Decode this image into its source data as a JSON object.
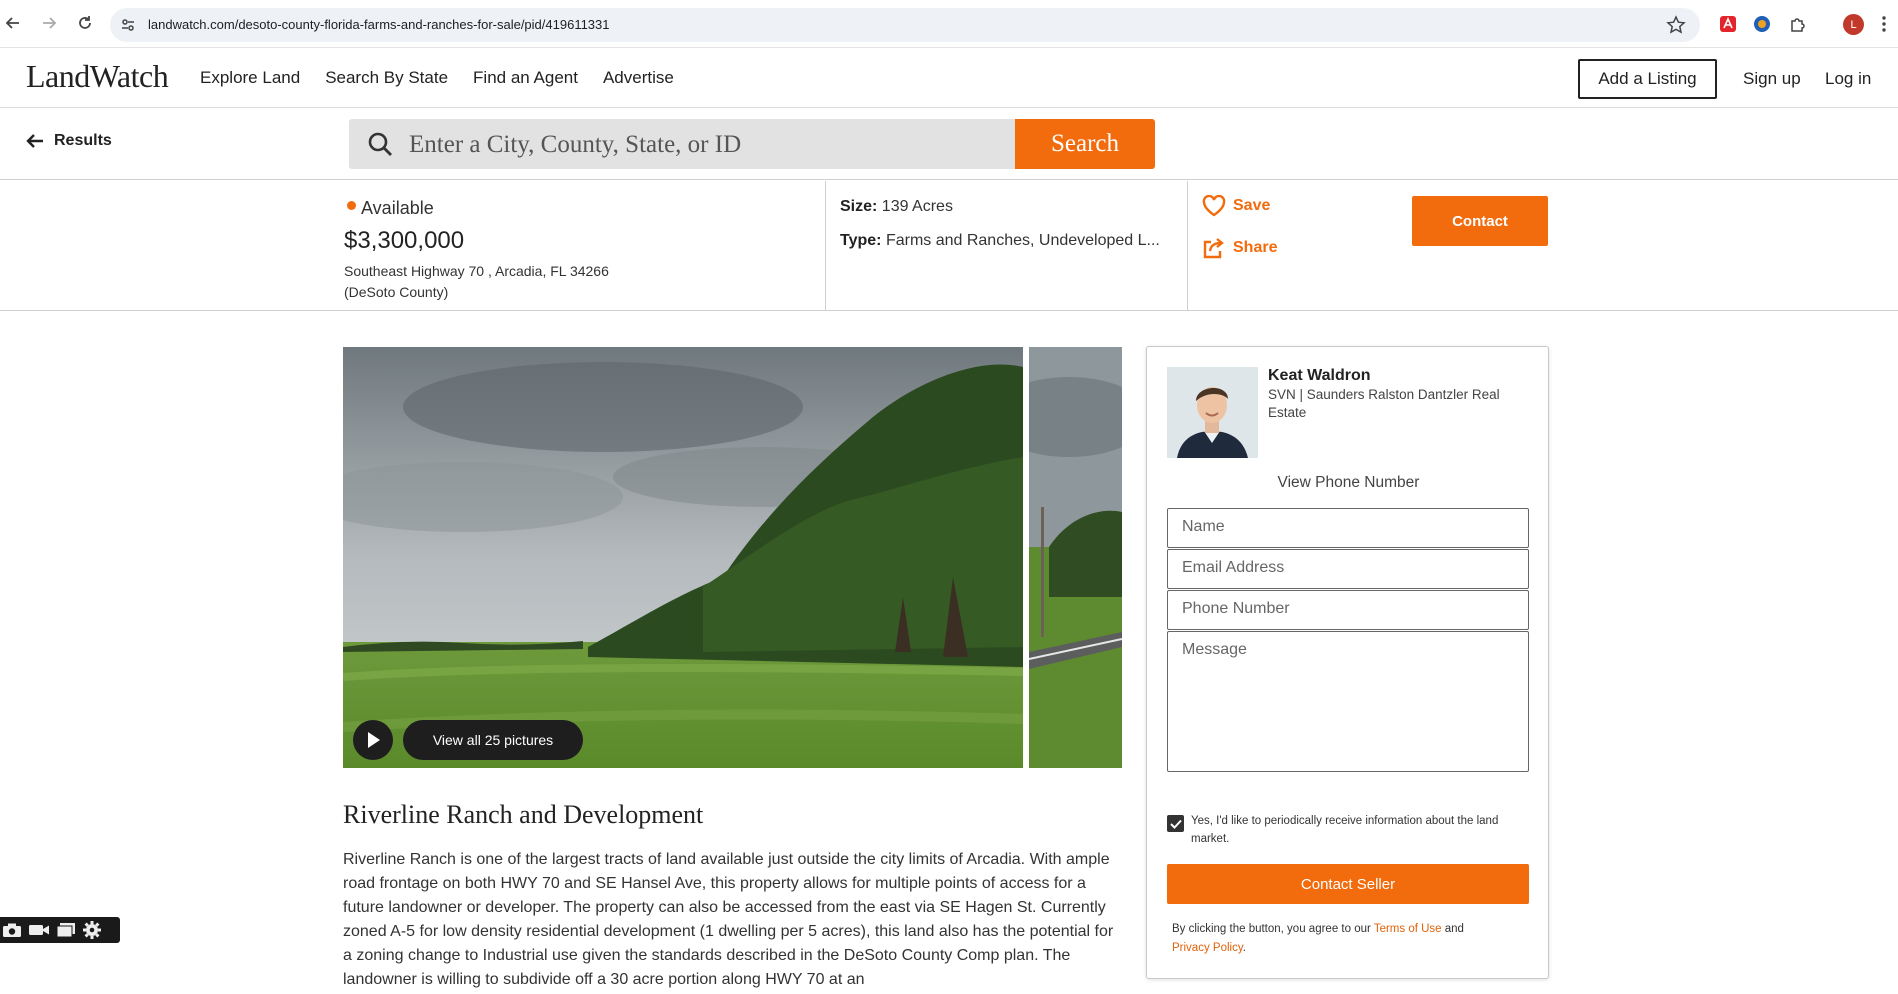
{
  "browser": {
    "url": "landwatch.com/desoto-county-florida-farms-and-ranches-for-sale/pid/419611331",
    "profile_initial": "L"
  },
  "header": {
    "logo": "LandWatch",
    "nav": [
      "Explore Land",
      "Search By State",
      "Find an Agent",
      "Advertise"
    ],
    "add_listing": "Add a Listing",
    "sign_up": "Sign up",
    "log_in": "Log in"
  },
  "search": {
    "back_label": "Results",
    "placeholder": "Enter a City, County, State, or ID",
    "button": "Search"
  },
  "summary": {
    "status": "Available",
    "price": "$3,300,000",
    "address_line1": "Southeast Highway 70 , Arcadia, FL 34266",
    "address_line2": "(DeSoto County)",
    "size_label": "Size:",
    "size_value": "139 Acres",
    "type_label": "Type:",
    "type_value": "Farms and Ranches, Undeveloped L...",
    "save": "Save",
    "share": "Share",
    "contact": "Contact"
  },
  "gallery": {
    "view_all": "View all 25 pictures"
  },
  "listing": {
    "title": "Riverline Ranch and Development",
    "description": "Riverline Ranch is one of the largest tracts of land available just outside the city limits of Arcadia. With ample road frontage on both HWY 70 and SE Hansel Ave, this property allows for multiple points of access for a future landowner or developer. The property can also be accessed from the east via SE Hagen St. Currently zoned A-5 for low density residential development (1 dwelling per 5 acres), this land also has the potential for a zoning change to Industrial use given the standards described in the DeSoto County Comp plan. The landowner is willing to subdivide off a 30 acre portion along HWY 70 at an"
  },
  "agent": {
    "name": "Keat Waldron",
    "company": "SVN | Saunders Ralston Dantzler Real Estate",
    "view_phone": "View Phone Number",
    "name_placeholder": "Name",
    "email_placeholder": "Email Address",
    "phone_placeholder": "Phone Number",
    "message_placeholder": "Message",
    "consent": "Yes, I'd like to periodically receive information about the land market.",
    "contact_seller": "Contact Seller",
    "terms_prefix": "By clicking the button, you agree to our ",
    "terms_link": "Terms of Use",
    "terms_and": " and",
    "privacy_link": "Privacy Policy",
    "terms_suffix": "."
  },
  "colors": {
    "accent": "#f26b0c",
    "dark": "#1e1e1e"
  }
}
